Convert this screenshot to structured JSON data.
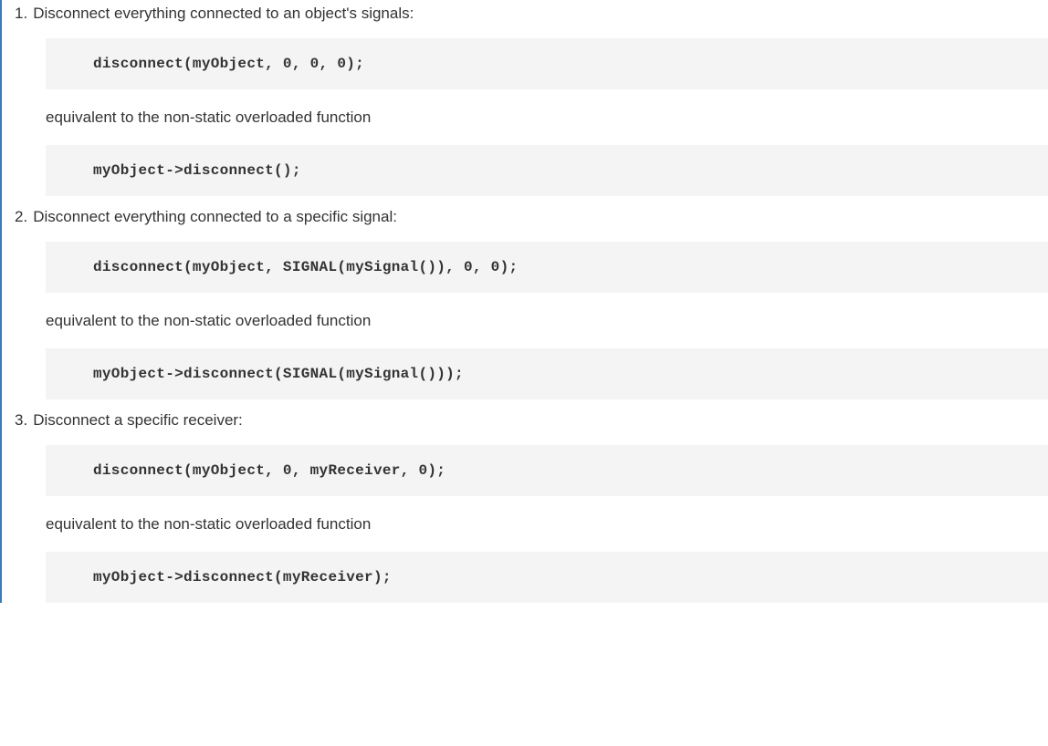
{
  "items": [
    {
      "number": "1.",
      "title": "Disconnect everything connected to an object's signals:",
      "code1": "disconnect(myObject, 0, 0, 0);",
      "equivalent": "equivalent to the non-static overloaded function",
      "code2": "myObject->disconnect();"
    },
    {
      "number": "2.",
      "title": "Disconnect everything connected to a specific signal:",
      "code1": "disconnect(myObject, SIGNAL(mySignal()), 0, 0);",
      "equivalent": "equivalent to the non-static overloaded function",
      "code2": "myObject->disconnect(SIGNAL(mySignal()));"
    },
    {
      "number": "3.",
      "title": "Disconnect a specific receiver:",
      "code1": "disconnect(myObject, 0, myReceiver, 0);",
      "equivalent": "equivalent to the non-static overloaded function",
      "code2": "myObject->disconnect(myReceiver);"
    }
  ]
}
